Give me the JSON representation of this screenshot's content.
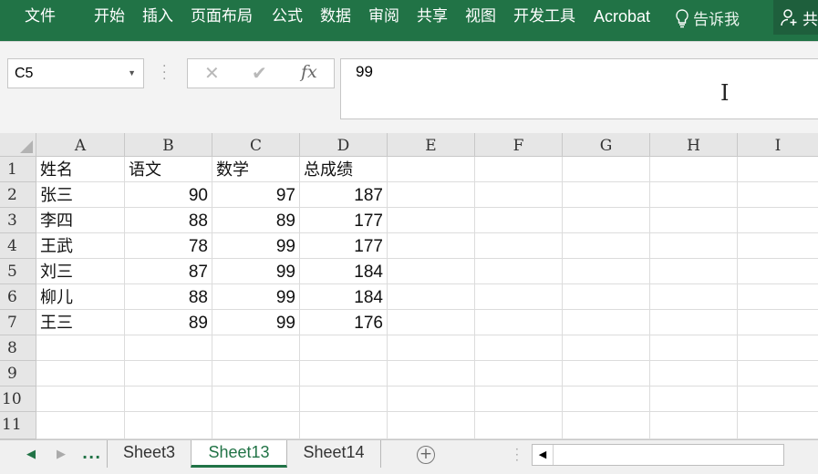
{
  "ribbon": {
    "tabs": [
      "文件",
      "开始",
      "插入",
      "页面布局",
      "公式",
      "数据",
      "审阅",
      "共享",
      "视图",
      "开发工具",
      "Acrobat"
    ],
    "tell_me": "告诉我",
    "share": "共",
    "color": "#217346"
  },
  "formula_bar": {
    "name_box": "C5",
    "cancel_icon": "✕",
    "enter_icon": "✔",
    "fx_label": "fx",
    "value": "99"
  },
  "columns": [
    "A",
    "B",
    "C",
    "D",
    "E",
    "F",
    "G",
    "H",
    "I"
  ],
  "rows": [
    "1",
    "2",
    "3",
    "4",
    "5",
    "6",
    "7",
    "8",
    "9",
    "10",
    "11"
  ],
  "cells": [
    [
      "姓名",
      "语文",
      "数学",
      "总成绩"
    ],
    [
      "张三",
      "90",
      "97",
      "187"
    ],
    [
      "李四",
      "88",
      "89",
      "177"
    ],
    [
      "王武",
      "78",
      "99",
      "177"
    ],
    [
      "刘三",
      "87",
      "99",
      "184"
    ],
    [
      "柳儿",
      "88",
      "99",
      "184"
    ],
    [
      "王三",
      "89",
      "99",
      "176"
    ]
  ],
  "sheets": {
    "ellipsis": "...",
    "tabs": [
      "Sheet3",
      "Sheet13",
      "Sheet14"
    ],
    "active": "Sheet13",
    "add_icon": "+"
  }
}
